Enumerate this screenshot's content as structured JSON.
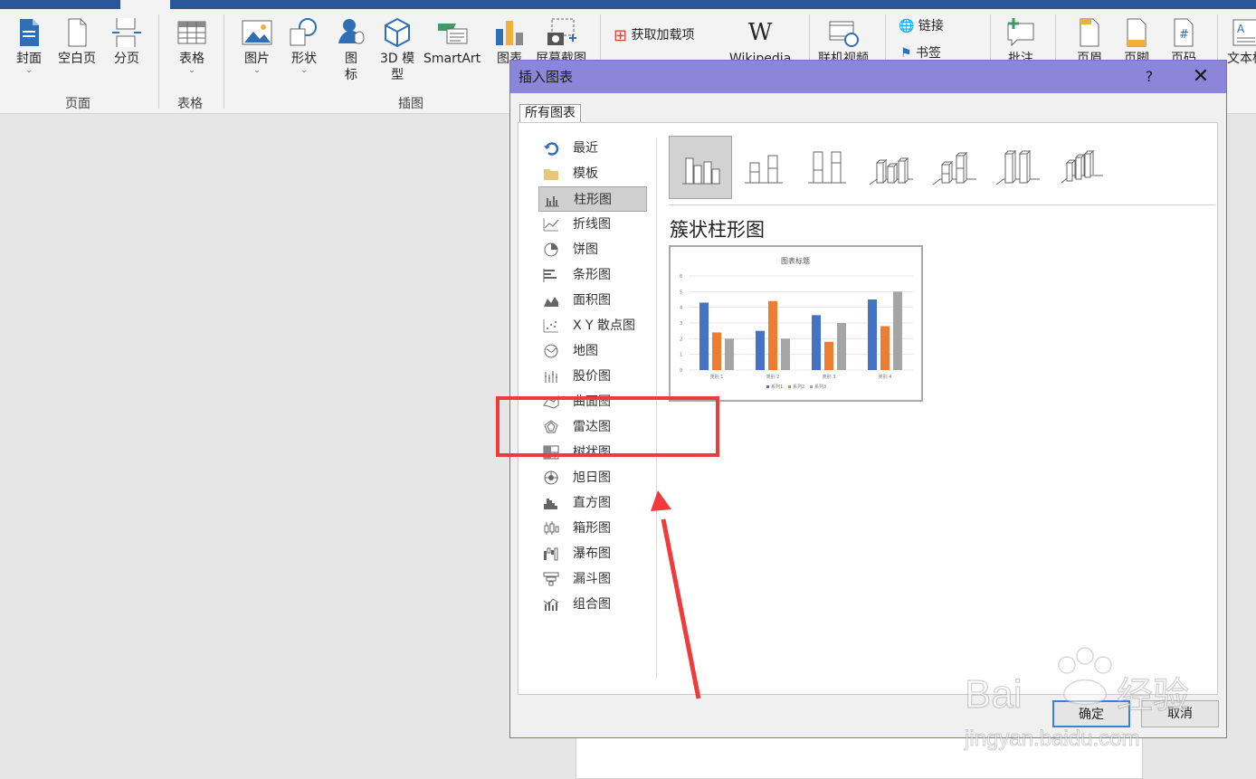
{
  "ribbon": {
    "buttons": {
      "cover": "封面",
      "blank_page": "空白页",
      "page_break": "分页",
      "table": "表格",
      "picture": "图片",
      "shapes": "形状",
      "icons_line1": "图",
      "icons_line2": "标",
      "model_line1": "3D 模",
      "model_line2": "型",
      "smartart": "SmartArt",
      "chart": "图表",
      "screenshot": "屏幕截图",
      "get_addins": "获取加载项",
      "wikipedia": "Wikipedia",
      "online_video": "联机视频",
      "link": "链接",
      "bookmark": "书签",
      "comment": "批注",
      "header": "页眉",
      "footer": "页脚",
      "page_number": "页码",
      "textbox": "文本框"
    },
    "groups": {
      "pages": "页面",
      "tables": "表格",
      "illustrations": "插图"
    }
  },
  "dialog": {
    "title": "插入图表",
    "help": "?",
    "close": "✕",
    "tab_all": "所有图表",
    "categories": [
      {
        "label": "最近",
        "icon": "recent-icon"
      },
      {
        "label": "模板",
        "icon": "folder-icon"
      },
      {
        "label": "柱形图",
        "icon": "column-chart-icon",
        "selected": true
      },
      {
        "label": "折线图",
        "icon": "line-chart-icon"
      },
      {
        "label": "饼图",
        "icon": "pie-chart-icon"
      },
      {
        "label": "条形图",
        "icon": "bar-chart-icon"
      },
      {
        "label": "面积图",
        "icon": "area-chart-icon"
      },
      {
        "label": "X Y 散点图",
        "icon": "scatter-chart-icon"
      },
      {
        "label": "地图",
        "icon": "map-chart-icon"
      },
      {
        "label": "股价图",
        "icon": "stock-chart-icon"
      },
      {
        "label": "曲面图",
        "icon": "surface-chart-icon"
      },
      {
        "label": "雷达图",
        "icon": "radar-chart-icon"
      },
      {
        "label": "树状图",
        "icon": "treemap-chart-icon"
      },
      {
        "label": "旭日图",
        "icon": "sunburst-chart-icon"
      },
      {
        "label": "直方图",
        "icon": "histogram-chart-icon"
      },
      {
        "label": "箱形图",
        "icon": "box-chart-icon"
      },
      {
        "label": "瀑布图",
        "icon": "waterfall-chart-icon"
      },
      {
        "label": "漏斗图",
        "icon": "funnel-chart-icon"
      },
      {
        "label": "组合图",
        "icon": "combo-chart-icon"
      }
    ],
    "selected_subtype_title": "簇状柱形图",
    "ok": "确定",
    "cancel": "取消"
  },
  "preview_chart": {
    "title": "图表标题",
    "yticks": [
      "0",
      "1",
      "2",
      "3",
      "4",
      "5",
      "6"
    ],
    "categories": [
      "类别 1",
      "类别 2",
      "类别 3",
      "类别 4"
    ],
    "legend": [
      "系列1",
      "系列2",
      "系列3"
    ],
    "colors": [
      "#4472c4",
      "#ed7d31",
      "#a5a5a5"
    ]
  },
  "chart_data": {
    "type": "bar",
    "title": "图表标题",
    "categories": [
      "类别 1",
      "类别 2",
      "类别 3",
      "类别 4"
    ],
    "series": [
      {
        "name": "系列1",
        "values": [
          4.3,
          2.5,
          3.5,
          4.5
        ]
      },
      {
        "name": "系列2",
        "values": [
          2.4,
          4.4,
          1.8,
          2.8
        ]
      },
      {
        "name": "系列3",
        "values": [
          2,
          2,
          3,
          5
        ]
      }
    ],
    "ylim": [
      0,
      6
    ],
    "grid": true,
    "legend": "bottom"
  },
  "watermark": {
    "brand": "Baidu经验",
    "url": "jingyan.baidu.com"
  }
}
